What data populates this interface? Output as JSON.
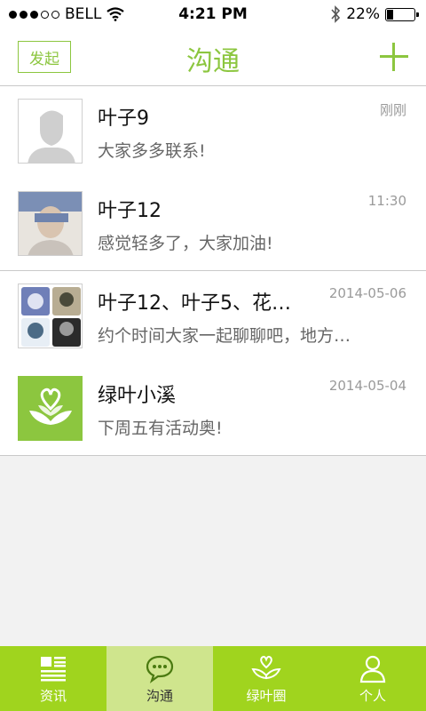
{
  "status": {
    "carrier": "BELL",
    "time": "4:21 PM",
    "battery": "22%",
    "battery_level": 0.22
  },
  "header": {
    "start_label": "发起",
    "title": "沟通"
  },
  "conversations": [
    {
      "name": "叶子9",
      "message": "大家多多联系!",
      "time": "刚刚"
    },
    {
      "name": "叶子12",
      "message": "感觉轻多了，大家加油!",
      "time": "11:30"
    },
    {
      "name": "叶子12、叶子5、花…",
      "message": "约个时间大家一起聊聊吧，地方…",
      "time": "2014-05-06"
    },
    {
      "name": "绿叶小溪",
      "message": "下周五有活动奥!",
      "time": "2014-05-04"
    }
  ],
  "tabs": [
    {
      "label": "资讯",
      "icon": "news-icon"
    },
    {
      "label": "沟通",
      "icon": "chat-bubble-icon"
    },
    {
      "label": "绿叶圈",
      "icon": "leaf-heart-icon"
    },
    {
      "label": "个人",
      "icon": "person-icon"
    }
  ],
  "colors": {
    "accent": "#8cc63f",
    "tabbar": "#a0d41e",
    "tab_active": "#cfe58d"
  }
}
